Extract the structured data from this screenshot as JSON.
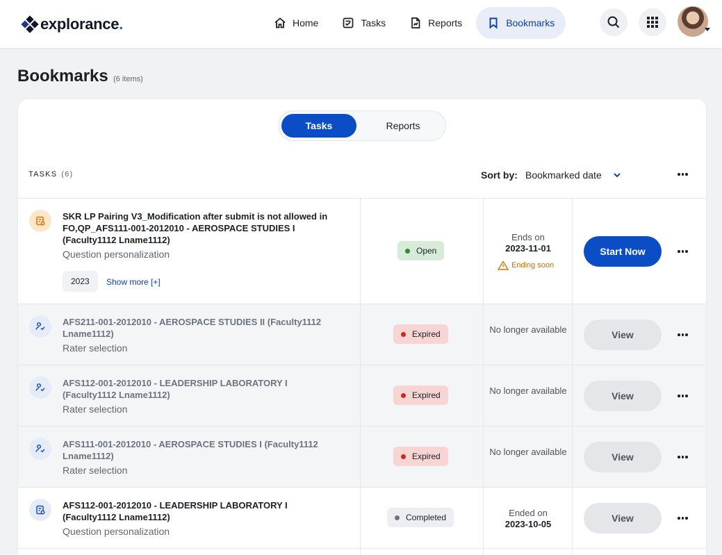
{
  "brand": {
    "name": "explorance",
    "dot": "."
  },
  "nav": {
    "home": "Home",
    "tasks": "Tasks",
    "reports": "Reports",
    "bookmarks": "Bookmarks"
  },
  "page": {
    "title": "Bookmarks",
    "count": "(6 items)"
  },
  "tabs": {
    "tasks": "Tasks",
    "reports": "Reports"
  },
  "toolbar": {
    "section_label": "TASKS",
    "section_count": "(6)",
    "sort_label": "Sort by:",
    "sort_value": "Bookmarked date"
  },
  "rows": [
    {
      "title": "SKR LP Pairing V3_Modification after submit is not allowed in FO,QP_AFS111-001-2012010 - AEROSPACE STUDIES I (Faculty1112 Lname1112)",
      "subtitle": "Question personalization",
      "chip": "2023",
      "show_more": "Show more [+]",
      "status": "Open",
      "date_label": "Ends on",
      "date_value": "2023-11-01",
      "warning": "Ending soon",
      "action": "Start Now"
    },
    {
      "title": "AFS211-001-2012010 - AEROSPACE STUDIES II (Faculty1112 Lname1112)",
      "subtitle": "Rater selection",
      "status": "Expired",
      "date_label": "No longer available",
      "action": "View"
    },
    {
      "title": "AFS112-001-2012010 - LEADERSHIP LABORATORY I (Faculty1112 Lname1112)",
      "subtitle": "Rater selection",
      "status": "Expired",
      "date_label": "No longer available",
      "action": "View"
    },
    {
      "title": "AFS111-001-2012010 - AEROSPACE STUDIES I (Faculty1112 Lname1112)",
      "subtitle": "Rater selection",
      "status": "Expired",
      "date_label": "No longer available",
      "action": "View"
    },
    {
      "title": "AFS112-001-2012010 - LEADERSHIP LABORATORY I (Faculty1112 Lname1112)",
      "subtitle": "Question personalization",
      "status": "Completed",
      "date_label": "Ended on",
      "date_value": "2023-10-05",
      "action": "View"
    }
  ],
  "colors": {
    "primary": "#0b4dc4",
    "open": "#2e8b3a",
    "expired": "#c92a1a",
    "warning": "#b86e0a"
  }
}
